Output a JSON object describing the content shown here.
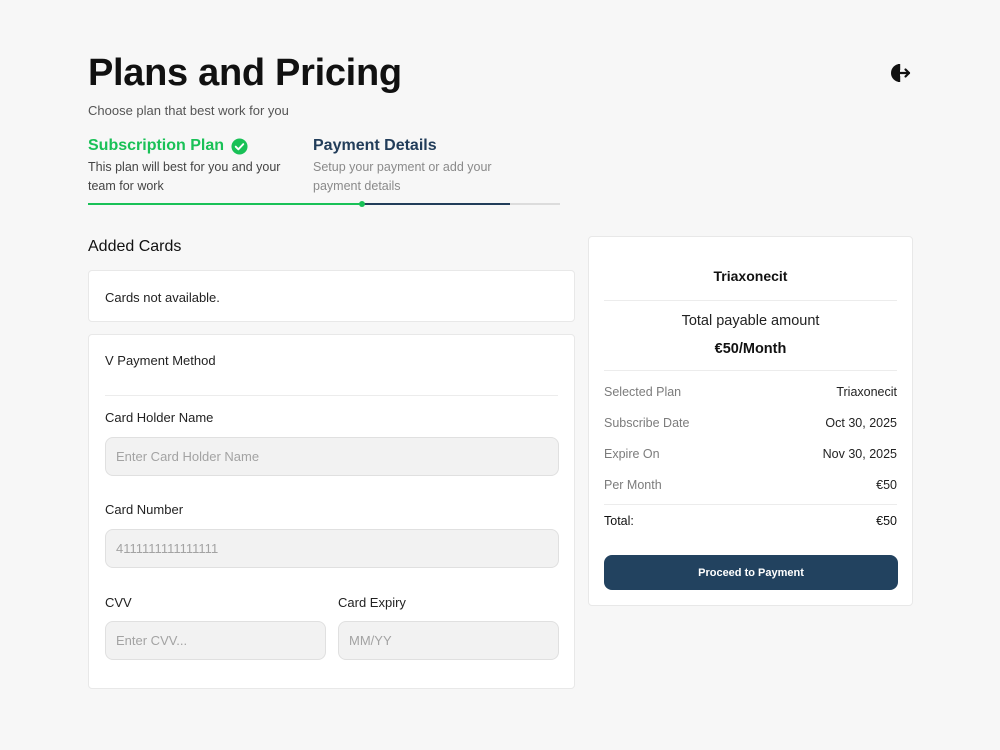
{
  "header": {
    "title": "Plans and Pricing",
    "subtitle": "Choose plan that best work for you",
    "logout_icon": "logout-icon"
  },
  "steps": [
    {
      "title": "Subscription Plan",
      "description": "This plan will best for you and your team for work",
      "status": "completed",
      "color": "#19c157"
    },
    {
      "title": "Payment Details",
      "description": "Setup your payment or add your payment details",
      "status": "active",
      "color": "#223d5a"
    }
  ],
  "progress": {
    "completed_fraction": 0.58,
    "active_fraction": 0.31
  },
  "added_cards": {
    "title": "Added Cards",
    "empty_message": "Cards not available."
  },
  "payment_form": {
    "heading": "V Payment Method",
    "card_holder": {
      "label": "Card Holder Name",
      "placeholder": "Enter Card Holder Name",
      "value": ""
    },
    "card_number": {
      "label": "Card Number",
      "placeholder": "4111111111111111",
      "value": ""
    },
    "cvv": {
      "label": "CVV",
      "placeholder": "Enter CVV...",
      "value": ""
    },
    "expiry": {
      "label": "Card Expiry",
      "placeholder": "MM/YY",
      "value": ""
    }
  },
  "summary": {
    "plan_name": "Triaxonecit",
    "total_label": "Total payable amount",
    "amount": "€50/Month",
    "rows": [
      {
        "label": "Selected Plan",
        "value": "Triaxonecit"
      },
      {
        "label": "Subscribe Date",
        "value": "Oct 30, 2025"
      },
      {
        "label": "Expire On",
        "value": "Nov 30, 2025"
      },
      {
        "label": "Per Month",
        "value": "€50"
      }
    ],
    "total": {
      "label": "Total:",
      "value": "€50"
    },
    "button_label": "Proceed to Payment",
    "button_color": "#22425f"
  }
}
